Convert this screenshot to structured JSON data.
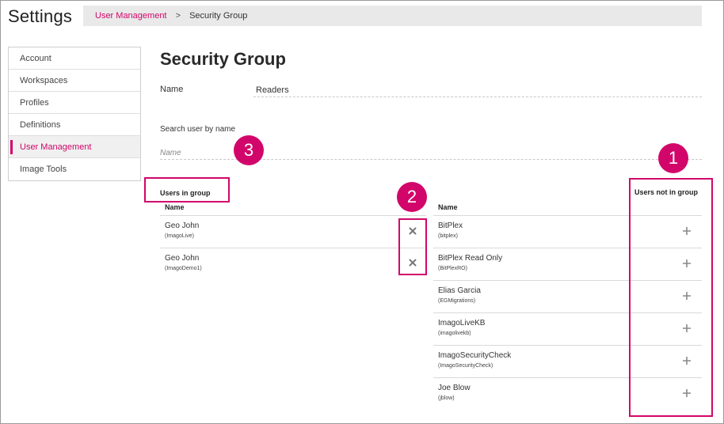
{
  "app": {
    "title": "Settings"
  },
  "breadcrumb": {
    "link": "User Management",
    "separator": ">",
    "current": "Security Group"
  },
  "sidebar": {
    "items": [
      {
        "label": "Account",
        "active": false
      },
      {
        "label": "Workspaces",
        "active": false
      },
      {
        "label": "Profiles",
        "active": false
      },
      {
        "label": "Definitions",
        "active": false
      },
      {
        "label": "User Management",
        "active": true
      },
      {
        "label": "Image Tools",
        "active": false
      }
    ]
  },
  "page": {
    "title": "Security Group"
  },
  "form": {
    "name_label": "Name",
    "name_value": "Readers",
    "search_label": "Search user by name",
    "search_placeholder": "Name"
  },
  "users_in_group": {
    "title": "Users in group",
    "column_header": "Name",
    "rows": [
      {
        "name": "Geo John",
        "login": "(ImagoLive)"
      },
      {
        "name": "Geo John",
        "login": "(ImagoDemo1)"
      }
    ]
  },
  "users_not_in_group": {
    "title": "Users not in group",
    "column_header": "Name",
    "rows": [
      {
        "name": "BitPlex",
        "login": "(bitplex)"
      },
      {
        "name": "BitPlex Read Only",
        "login": "(BitPlexRO)"
      },
      {
        "name": "Elias Garcia",
        "login": "(EGMigrations)"
      },
      {
        "name": "ImagoLiveKB",
        "login": "(imagolivekb)"
      },
      {
        "name": "ImagoSecurityCheck",
        "login": "(ImagoSecurityCheck)"
      },
      {
        "name": "Joe Blow",
        "login": "(jblow)"
      }
    ]
  },
  "callouts": [
    "1",
    "2",
    "3"
  ],
  "icons": {
    "remove": "close-icon",
    "add": "plus-icon"
  },
  "colors": {
    "accent": "#d2066a",
    "breadcrumb_bg": "#e9e9e9"
  }
}
